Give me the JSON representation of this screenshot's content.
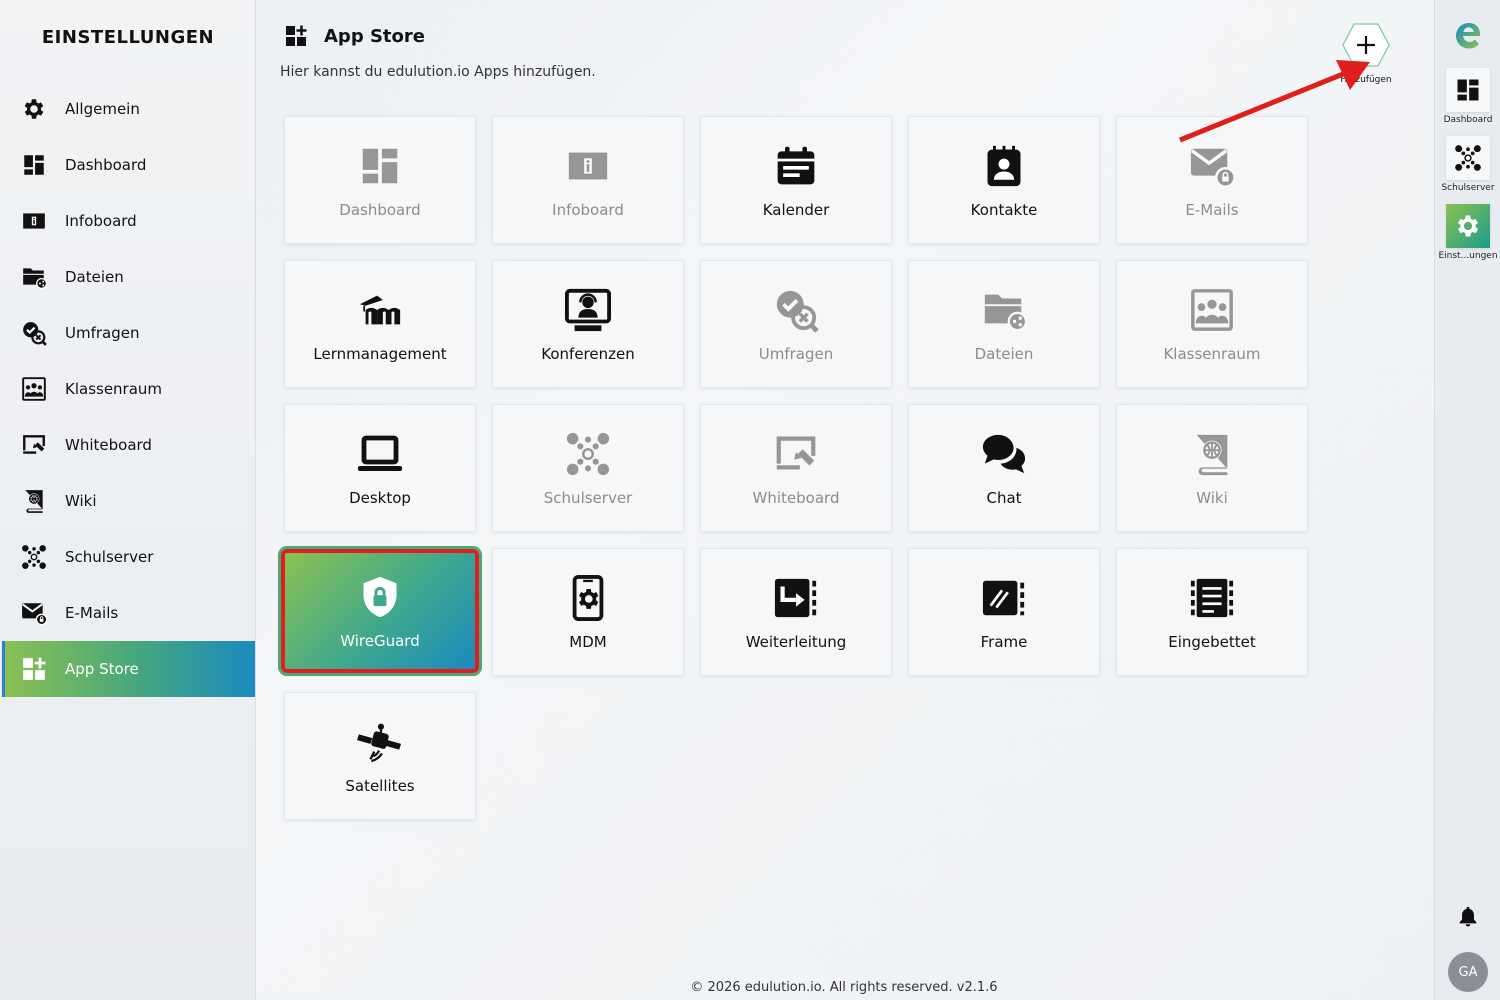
{
  "sidebar": {
    "title": "EINSTELLUNGEN",
    "items": [
      {
        "label": "Allgemein",
        "icon": "gear-icon"
      },
      {
        "label": "Dashboard",
        "icon": "dashboard-icon"
      },
      {
        "label": "Infoboard",
        "icon": "infoboard-icon"
      },
      {
        "label": "Dateien",
        "icon": "folder-share-icon"
      },
      {
        "label": "Umfragen",
        "icon": "survey-icon"
      },
      {
        "label": "Klassenraum",
        "icon": "classroom-icon"
      },
      {
        "label": "Whiteboard",
        "icon": "whiteboard-icon"
      },
      {
        "label": "Wiki",
        "icon": "wiki-icon"
      },
      {
        "label": "Schulserver",
        "icon": "network-icon"
      },
      {
        "label": "E-Mails",
        "icon": "mail-icon"
      },
      {
        "label": "App Store",
        "icon": "app-store-icon",
        "active": true
      }
    ]
  },
  "header": {
    "title": "App Store",
    "subtitle": "Hier kannst du edulution.io Apps hinzufügen.",
    "add_label": "Hinzufügen"
  },
  "tiles": [
    {
      "label": "Dashboard",
      "icon": "dashboard-icon",
      "dimmed": true
    },
    {
      "label": "Infoboard",
      "icon": "infoboard-icon",
      "dimmed": true
    },
    {
      "label": "Kalender",
      "icon": "calendar-icon",
      "dimmed": false
    },
    {
      "label": "Kontakte",
      "icon": "contacts-icon",
      "dimmed": false
    },
    {
      "label": "E-Mails",
      "icon": "mail-icon",
      "dimmed": true
    },
    {
      "label": "Lernmanagement",
      "icon": "moodle-icon",
      "dimmed": false
    },
    {
      "label": "Konferenzen",
      "icon": "conference-icon",
      "dimmed": false
    },
    {
      "label": "Umfragen",
      "icon": "survey-icon",
      "dimmed": true
    },
    {
      "label": "Dateien",
      "icon": "folder-share-icon",
      "dimmed": true
    },
    {
      "label": "Klassenraum",
      "icon": "classroom-icon",
      "dimmed": true
    },
    {
      "label": "Desktop",
      "icon": "laptop-icon",
      "dimmed": false
    },
    {
      "label": "Schulserver",
      "icon": "network-icon",
      "dimmed": true
    },
    {
      "label": "Whiteboard",
      "icon": "whiteboard-icon",
      "dimmed": true
    },
    {
      "label": "Chat",
      "icon": "chat-icon",
      "dimmed": false
    },
    {
      "label": "Wiki",
      "icon": "wiki-icon",
      "dimmed": true
    },
    {
      "label": "WireGuard",
      "icon": "shield-lock-icon",
      "dimmed": false,
      "selected": true
    },
    {
      "label": "MDM",
      "icon": "mdm-icon",
      "dimmed": false
    },
    {
      "label": "Weiterleitung",
      "icon": "forward-icon",
      "dimmed": false
    },
    {
      "label": "Frame",
      "icon": "frame-icon",
      "dimmed": false
    },
    {
      "label": "Eingebettet",
      "icon": "embedded-icon",
      "dimmed": false
    },
    {
      "label": "Satellites",
      "icon": "satellite-icon",
      "dimmed": false
    }
  ],
  "rail": {
    "items": [
      {
        "label": "Dashboard",
        "icon": "dashboard-icon"
      },
      {
        "label": "Schulserver",
        "icon": "network-icon"
      },
      {
        "label": "Einst...ungen",
        "icon": "gear-icon",
        "active": true
      }
    ],
    "avatar": "GA"
  },
  "colors": {
    "accent_green": "#8cc152",
    "accent_blue": "#1a8bbf",
    "highlight_red": "#e01e1e"
  },
  "footer": "© 2026 edulution.io. All rights reserved. v2.1.6"
}
